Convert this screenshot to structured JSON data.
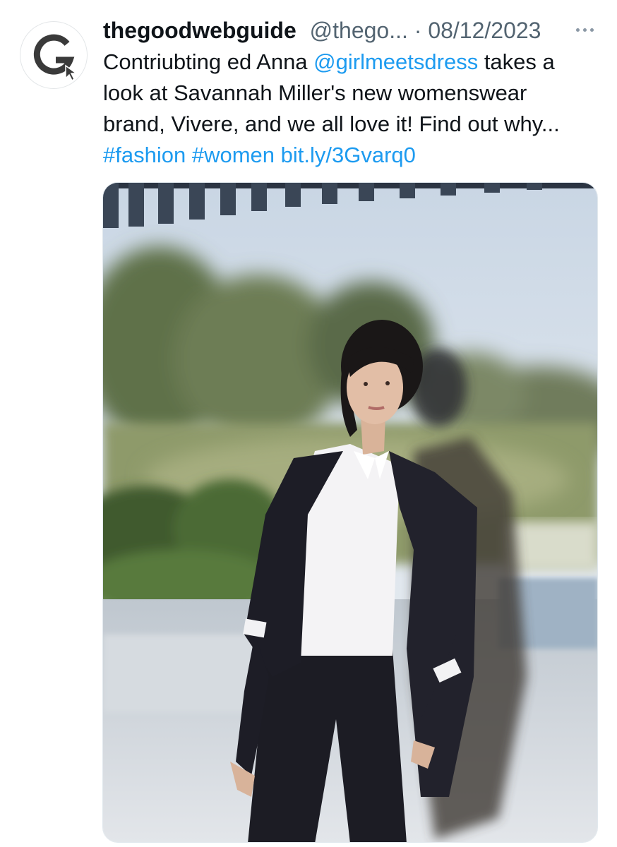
{
  "tweet": {
    "author": {
      "display_name": "thegoodwebguide",
      "handle": "@thego...",
      "avatar_letter": "G"
    },
    "separator": "·",
    "date": "08/12/2023",
    "more_icon": "more-horizontal-icon",
    "text": {
      "line1_a": "Contriubting ed Anna ",
      "mention": "@girlmeetsdress",
      "line1_b": " takes a",
      "line2": "look at Savannah Miller's new womenswear",
      "line3": "brand, Vivere, and we all love it! Find out why...",
      "hashtag1": "#fashion",
      "hashtag2": "#women",
      "url": "bit.ly/3Gvarq0"
    },
    "media": {
      "type": "photo"
    }
  },
  "colors": {
    "text": "#0f1419",
    "secondary": "#536471",
    "link": "#1d9bf0",
    "avatar_ink": "#3a3a3a"
  }
}
